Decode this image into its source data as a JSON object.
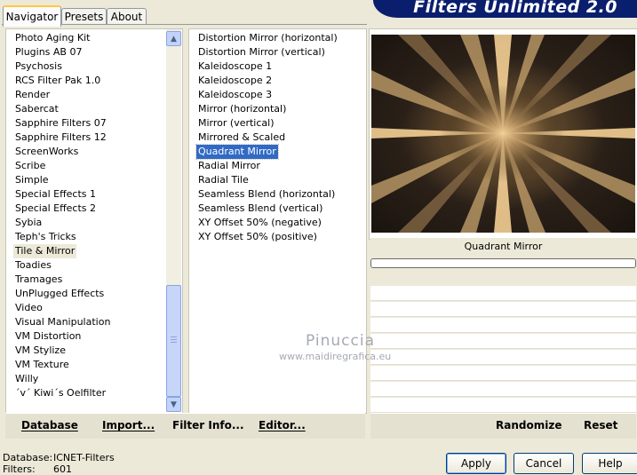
{
  "window": {
    "title": "Filters Unlimited 2.0"
  },
  "tabs": [
    {
      "label": "Navigator",
      "active": true
    },
    {
      "label": "Presets",
      "active": false
    },
    {
      "label": "About",
      "active": false
    }
  ],
  "categories": {
    "items": [
      "Photo Aging Kit",
      "Plugins AB 07",
      "Psychosis",
      "RCS Filter Pak 1.0",
      "Render",
      "Sabercat",
      "Sapphire Filters 07",
      "Sapphire Filters 12",
      "ScreenWorks",
      "Scribe",
      "Simple",
      "Special Effects 1",
      "Special Effects 2",
      "Sybia",
      "Teph's Tricks",
      "Tile & Mirror",
      "Toadies",
      "Tramages",
      "UnPlugged Effects",
      "Video",
      "Visual Manipulation",
      "VM Distortion",
      "VM Stylize",
      "VM Texture",
      "Willy",
      "´v´ Kiwi´s Oelfilter"
    ],
    "selected_index": 15
  },
  "filters": {
    "items": [
      "Distortion Mirror (horizontal)",
      "Distortion Mirror (vertical)",
      "Kaleidoscope 1",
      "Kaleidoscope 2",
      "Kaleidoscope 3",
      "Mirror (horizontal)",
      "Mirror (vertical)",
      "Mirrored & Scaled",
      "Quadrant Mirror",
      "Radial Mirror",
      "Radial Tile",
      "Seamless Blend (horizontal)",
      "Seamless Blend (vertical)",
      "XY Offset 50% (negative)",
      "XY Offset 50% (positive)"
    ],
    "selected_index": 8
  },
  "preview": {
    "filter_name": "Quadrant Mirror"
  },
  "toolbar": {
    "database": "Database",
    "import": "Import...",
    "filter_info": "Filter Info...",
    "editor": "Editor...",
    "randomize": "Randomize",
    "reset": "Reset"
  },
  "status": {
    "database_label": "Database:",
    "database_value": "ICNET-Filters",
    "filters_label": "Filters:",
    "filters_value": "601"
  },
  "buttons": {
    "apply": "Apply",
    "cancel": "Cancel",
    "help": "Help"
  },
  "watermark": {
    "name": "Pinuccia",
    "url": "www.maidiregrafica.eu"
  }
}
